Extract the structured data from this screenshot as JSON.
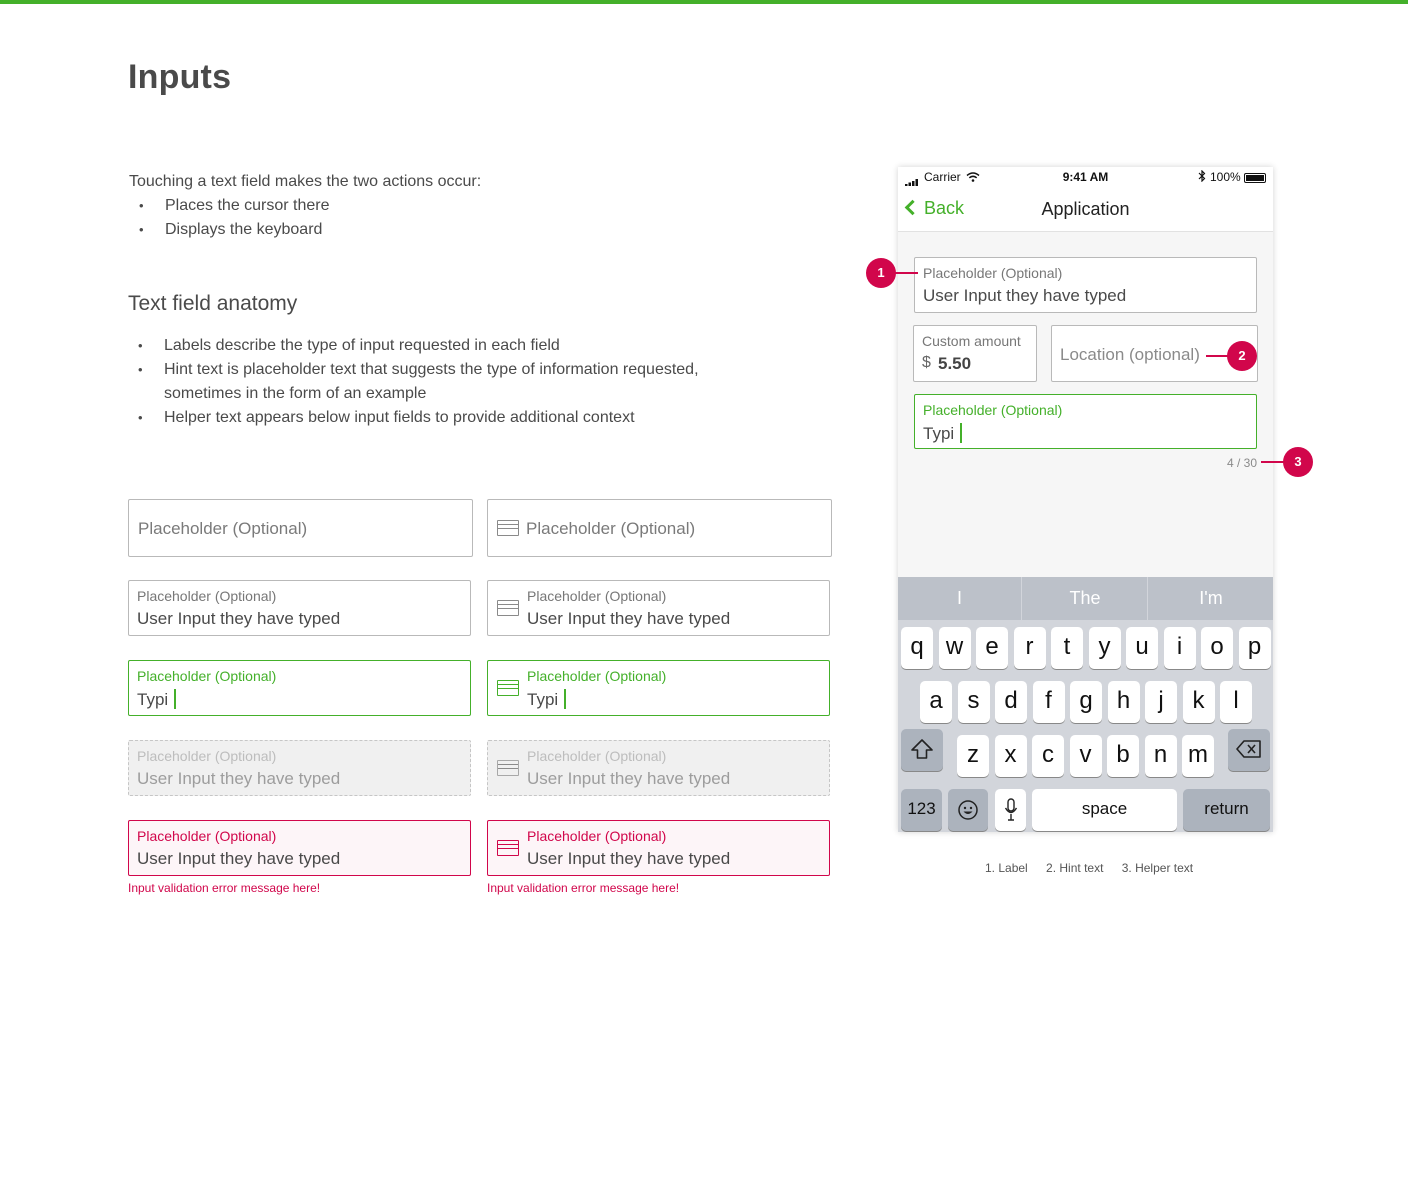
{
  "page": {
    "title": "Inputs",
    "intro": "Touching a text field makes the two actions occur:",
    "intro_bullets": [
      "Places the cursor there",
      "Displays the keyboard"
    ],
    "anatomy_heading": "Text field anatomy",
    "anatomy_bullets": [
      "Labels describe the type of input requested in each field",
      "Hint text is placeholder text that suggests the type of information requested, sometimes in the form of an example",
      "Helper text appears below input fields to provide additional context"
    ]
  },
  "fields": {
    "placeholder": "Placeholder (Optional)",
    "label": "Placeholder (Optional)",
    "value": "User Input they have typed",
    "typing": "Typi",
    "error_message": "Input validation error message here!"
  },
  "phone": {
    "carrier": "Carrier",
    "time": "9:41 AM",
    "battery": "100%",
    "back": "Back",
    "title": "Application",
    "field1_label": "Placeholder (Optional)",
    "field1_value": "User Input they have typed",
    "amount_label": "Custom amount",
    "amount_currency": "$",
    "amount_value": "5.50",
    "location_hint": "Location (optional)",
    "field3_label": "Placeholder (Optional)",
    "field3_value": "Typi",
    "counter": "4 / 30",
    "suggestions": [
      "I",
      "The",
      "I'm"
    ],
    "row1": [
      "q",
      "w",
      "e",
      "r",
      "t",
      "y",
      "u",
      "i",
      "o",
      "p"
    ],
    "row2": [
      "a",
      "s",
      "d",
      "f",
      "g",
      "h",
      "j",
      "k",
      "l"
    ],
    "row3": [
      "z",
      "x",
      "c",
      "v",
      "b",
      "n",
      "m"
    ],
    "key_123": "123",
    "key_space": "space",
    "key_return": "return"
  },
  "markers": [
    "1",
    "2",
    "3"
  ],
  "legend": [
    "1. Label",
    "2. Hint text",
    "3. Helper text"
  ],
  "colors": {
    "accent": "#44b02a",
    "error": "#d1064b"
  },
  "icons": [
    "credit-card-icon",
    "chevron-left-icon",
    "wifi-icon",
    "bluetooth-icon",
    "battery-icon",
    "shift-icon",
    "delete-icon",
    "emoji-icon",
    "microphone-icon"
  ]
}
